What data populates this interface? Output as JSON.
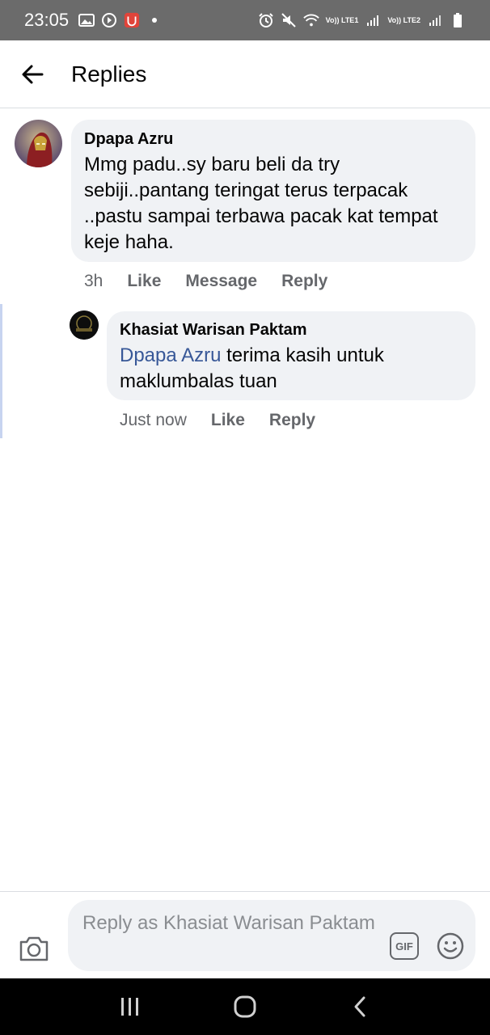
{
  "status_bar": {
    "time": "23:05",
    "net1": "Vo)) LTE1",
    "net2": "Vo)) LTE2"
  },
  "header": {
    "title": "Replies"
  },
  "comment": {
    "author": "Dpapa Azru",
    "text": "Mmg padu..sy baru beli da try sebiji..pantang teringat terus terpacak ..pastu sampai terbawa pacak kat tempat keje haha.",
    "time": "3h",
    "like_label": "Like",
    "message_label": "Message",
    "reply_label": "Reply"
  },
  "reply": {
    "author": "Khasiat Warisan Paktam",
    "mention": "Dpapa Azru",
    "text": " terima kasih untuk maklumbalas tuan",
    "time": "Just now",
    "like_label": "Like",
    "reply_label": "Reply"
  },
  "composer": {
    "placeholder": "Reply as Khasiat Warisan Paktam",
    "gif_label": "GIF"
  },
  "colors": {
    "status_bar": "#6b6b6b",
    "bubble": "#f0f2f5",
    "mention": "#385898",
    "action_text": "#65676b",
    "thread_line": "#c7d4f0"
  }
}
